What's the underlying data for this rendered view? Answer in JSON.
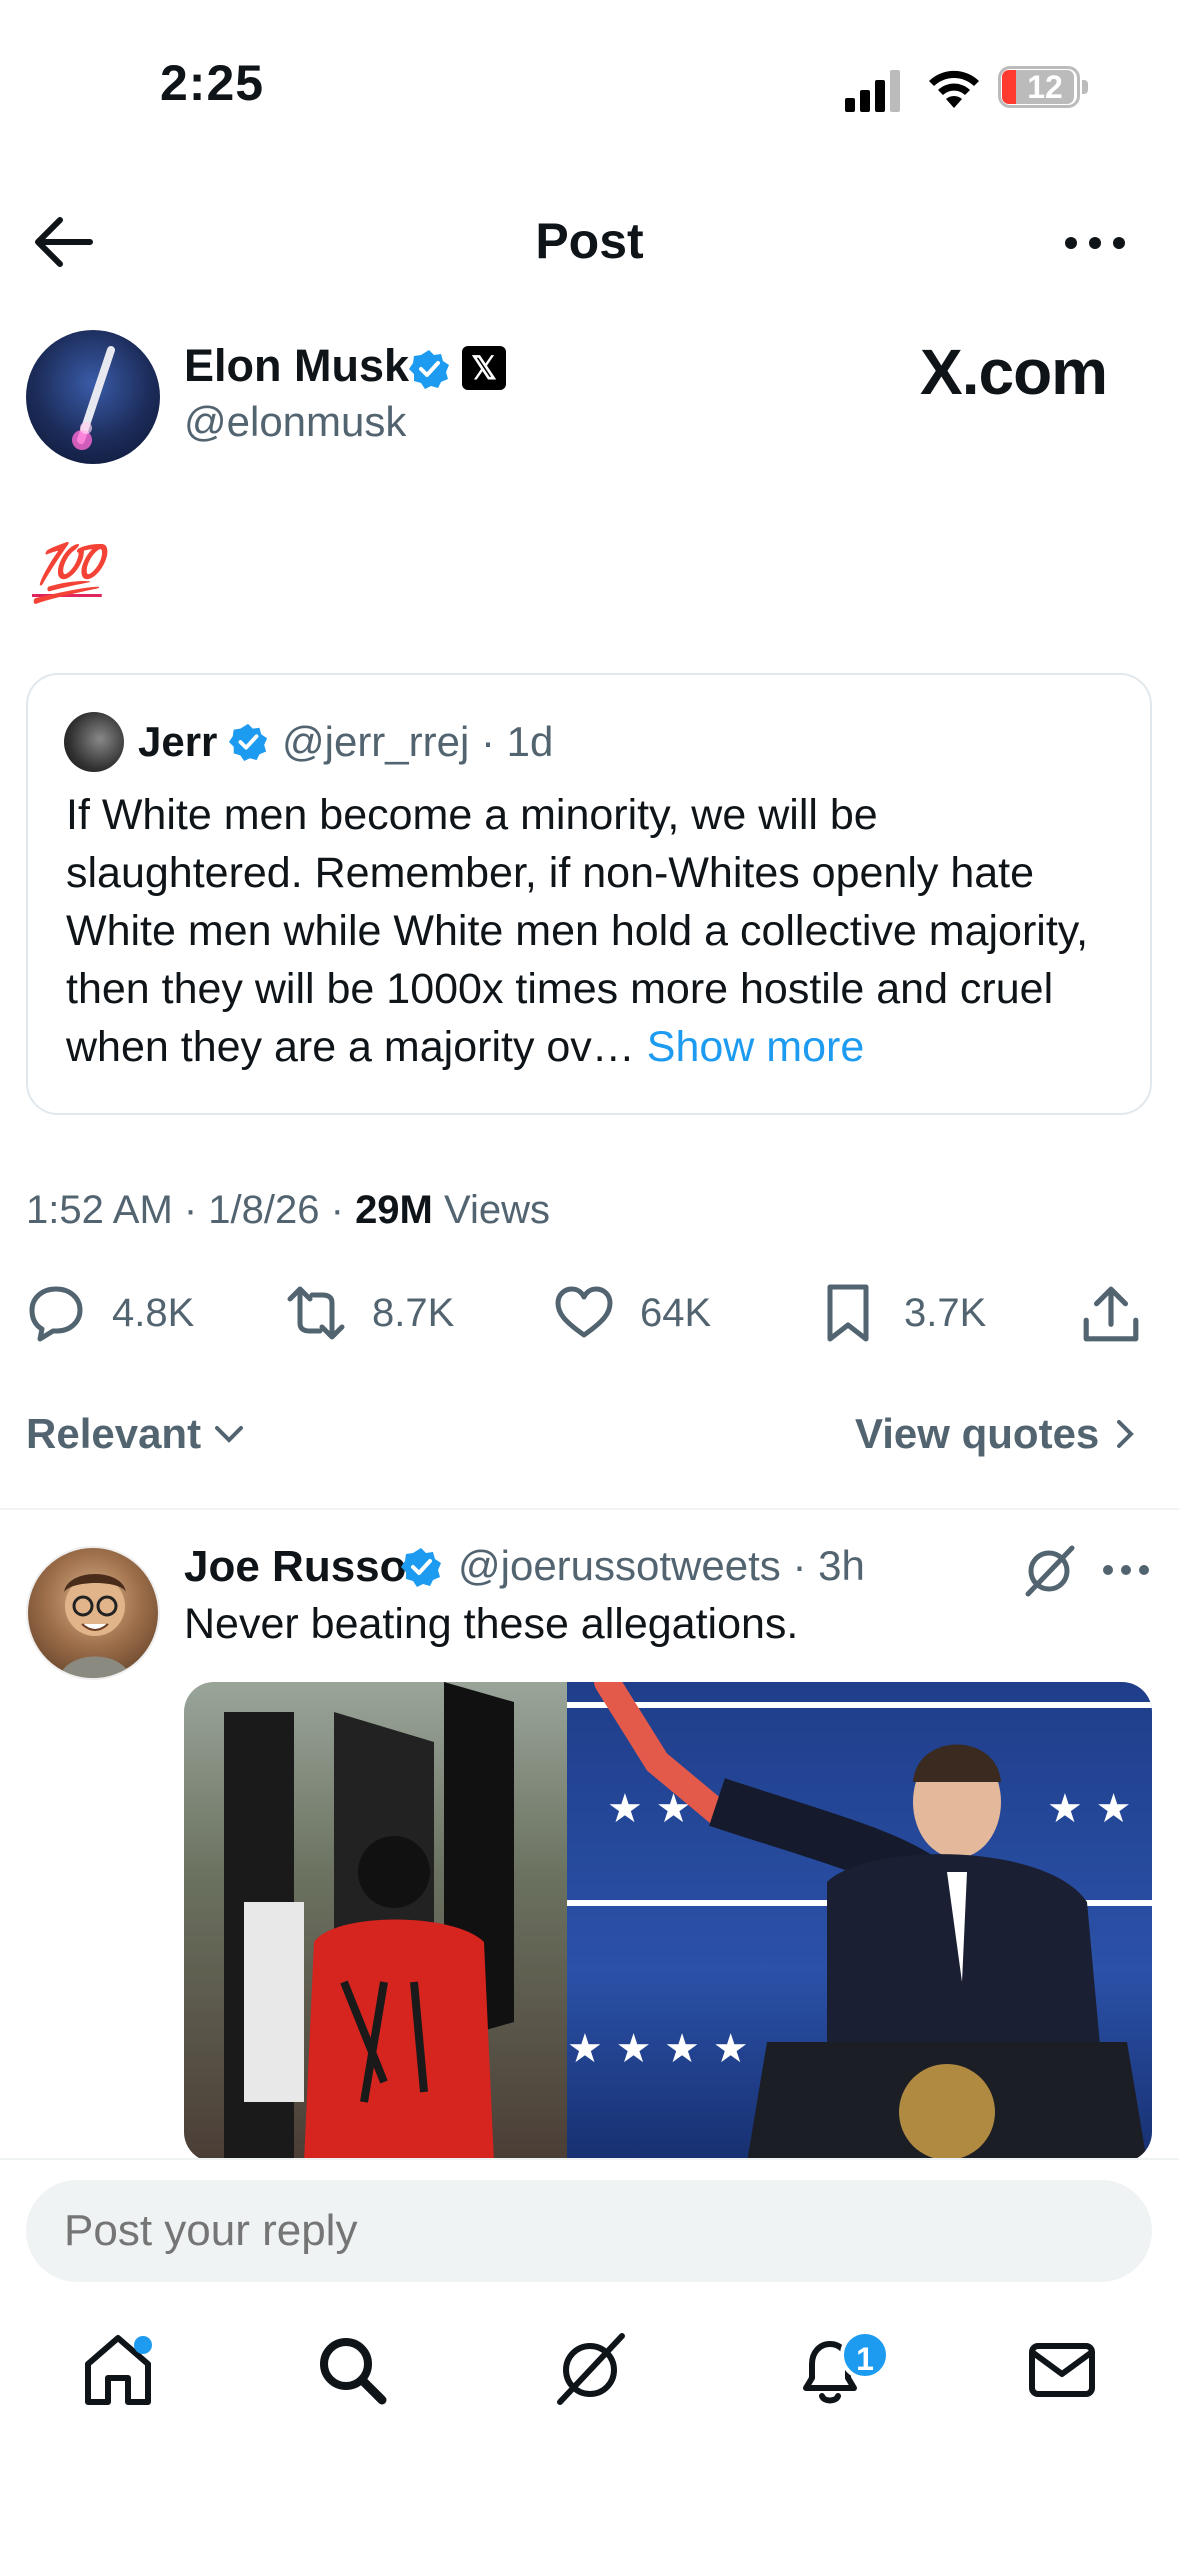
{
  "status_bar": {
    "time": "2:25",
    "battery": "12"
  },
  "nav": {
    "title": "Post"
  },
  "post": {
    "author_name": "Elon Musk",
    "author_handle": "@elonmusk",
    "header_logo": "X.com",
    "body_emoji": "💯",
    "quoted": {
      "name": "Jerr",
      "handle_time": "@jerr_rrej · 1d",
      "text": "If White men become a minority, we will be slaughtered. Remember, if non-Whites openly hate White men while White men hold a collective majority, then they will be 1000x times more hostile and cruel when they are a majority ov… ",
      "show_more": "Show more"
    },
    "meta_time": "1:52 AM · 1/8/26 · ",
    "meta_views_count": "29M",
    "meta_views_label": " Views",
    "stats": {
      "replies": "4.8K",
      "reposts": "8.7K",
      "likes": "64K",
      "bookmarks": "3.7K"
    }
  },
  "sort": {
    "label": "Relevant",
    "view_quotes": "View quotes"
  },
  "reply": {
    "name": "Joe Russo",
    "handle_time": "@joerussotweets · 3h",
    "text": "Never beating these allegations."
  },
  "composer": {
    "placeholder": "Post your reply"
  },
  "tabbar": {
    "notifications_badge": "1"
  },
  "colors": {
    "accent": "#1d9bf0",
    "text": "#0f1419",
    "secondary": "#536471"
  }
}
